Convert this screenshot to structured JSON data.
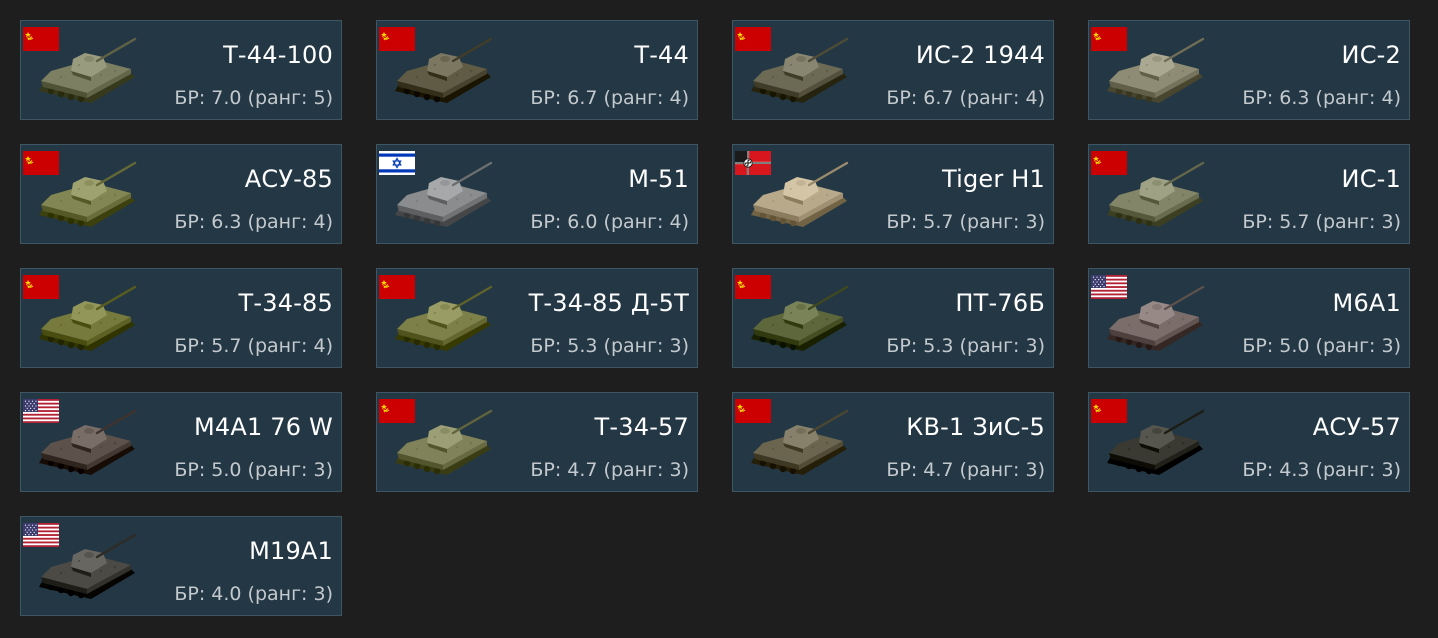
{
  "vehicles": [
    {
      "name": "Т-44-100",
      "br": "БР: 7.0 (ранг: 5)",
      "nation": "ussr",
      "tank_color": "#7d7f62"
    },
    {
      "name": "Т-44",
      "br": "БР: 6.7 (ранг: 4)",
      "nation": "ussr",
      "tank_color": "#5f5b45"
    },
    {
      "name": "ИС-2 1944",
      "br": "БР: 6.7 (ранг: 4)",
      "nation": "ussr",
      "tank_color": "#6c6a55"
    },
    {
      "name": "ИС-2",
      "br": "БР: 6.3 (ранг: 4)",
      "nation": "ussr",
      "tank_color": "#8e8c74"
    },
    {
      "name": "АСУ-85",
      "br": "БР: 6.3 (ранг: 4)",
      "nation": "ussr",
      "tank_color": "#828654"
    },
    {
      "name": "M-51",
      "br": "БР: 6.0 (ранг: 4)",
      "nation": "israel",
      "tank_color": "#8a8c8e"
    },
    {
      "name": "Tiger H1",
      "br": "БР: 5.7 (ранг: 3)",
      "nation": "germany",
      "tank_color": "#b7a98a"
    },
    {
      "name": "ИС-1",
      "br": "БР: 5.7 (ранг: 3)",
      "nation": "ussr",
      "tank_color": "#838568"
    },
    {
      "name": "Т-34-85",
      "br": "БР: 5.7 (ранг: 4)",
      "nation": "ussr",
      "tank_color": "#767a3c"
    },
    {
      "name": "Т-34-85 Д-5Т",
      "br": "БР: 5.3 (ранг: 3)",
      "nation": "ussr",
      "tank_color": "#7d8048"
    },
    {
      "name": "ПТ-76Б",
      "br": "БР: 5.3 (ранг: 3)",
      "nation": "ussr",
      "tank_color": "#5e663c"
    },
    {
      "name": "M6A1",
      "br": "БР: 5.0 (ранг: 3)",
      "nation": "usa",
      "tank_color": "#7b6e6a"
    },
    {
      "name": "M4A1 76 W",
      "br": "БР: 5.0 (ранг: 3)",
      "nation": "usa",
      "tank_color": "#5d514b"
    },
    {
      "name": "Т-34-57",
      "br": "БР: 4.7 (ранг: 3)",
      "nation": "ussr",
      "tank_color": "#80835a"
    },
    {
      "name": "КВ-1 ЗиС-5",
      "br": "БР: 4.7 (ранг: 3)",
      "nation": "ussr",
      "tank_color": "#6b6550"
    },
    {
      "name": "АСУ-57",
      "br": "БР: 4.3 (ранг: 3)",
      "nation": "ussr",
      "tank_color": "#3a3a33"
    },
    {
      "name": "M19A1",
      "br": "БР: 4.0 (ранг: 3)",
      "nation": "usa",
      "tank_color": "#4b4a45"
    }
  ]
}
